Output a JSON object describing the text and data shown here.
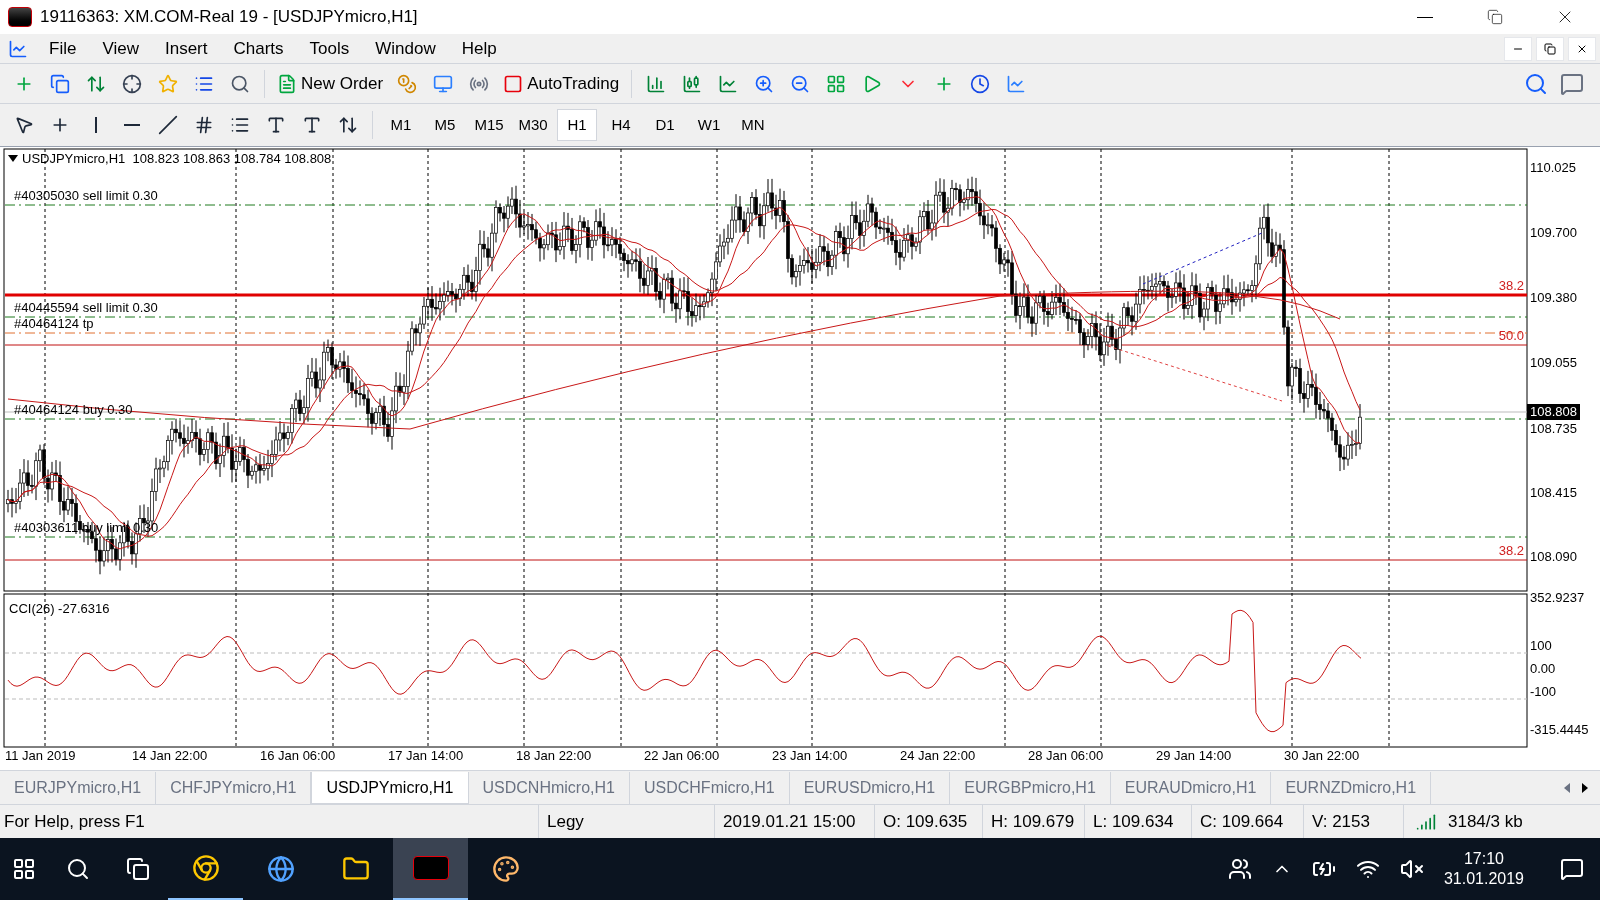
{
  "window": {
    "title": "19116363: XM.COM-Real 19 - [USDJPYmicro,H1]"
  },
  "menu": [
    "File",
    "View",
    "Insert",
    "Charts",
    "Tools",
    "Window",
    "Help"
  ],
  "toolbar": {
    "new_order": "New Order",
    "autotrading": "AutoTrading"
  },
  "timeframes": [
    {
      "label": "M1",
      "selected": false
    },
    {
      "label": "M5",
      "selected": false
    },
    {
      "label": "M15",
      "selected": false
    },
    {
      "label": "M30",
      "selected": false
    },
    {
      "label": "H1",
      "selected": true
    },
    {
      "label": "H4",
      "selected": false
    },
    {
      "label": "D1",
      "selected": false
    },
    {
      "label": "W1",
      "selected": false
    },
    {
      "label": "MN",
      "selected": false
    }
  ],
  "chart": {
    "header": "USDJPYmicro,H1  108.823 108.863 108.784 108.808",
    "orders": [
      {
        "label": "#40305030 sell limit 0.30",
        "kind": "pending"
      },
      {
        "label": "#40445594 sell limit 0.30",
        "kind": "pending"
      },
      {
        "label": "#40464124 tp",
        "kind": "tp"
      },
      {
        "label": "#40464124 buy 0.30",
        "kind": "pending"
      },
      {
        "label": "#40303611 buy limit 0.30",
        "kind": "pending"
      }
    ],
    "fib_labels": [
      "38.2",
      "50.0",
      "38.2"
    ],
    "price_axis": [
      "110.025",
      "109.700",
      "109.380",
      "109.055",
      "108.735",
      "108.415",
      "108.090"
    ],
    "current_price": "108.808",
    "time_axis": [
      "11 Jan 2019",
      "14 Jan 22:00",
      "16 Jan 06:00",
      "17 Jan 14:00",
      "18 Jan 22:00",
      "22 Jan 06:00",
      "23 Jan 14:00",
      "24 Jan 22:00",
      "28 Jan 06:00",
      "29 Jan 14:00",
      "30 Jan 22:00"
    ],
    "indicator": {
      "label": "CCI(26) -27.6316",
      "axis": [
        "352.9237",
        "100",
        "0.00",
        "-100",
        "-315.4445"
      ]
    }
  },
  "chart_tabs": [
    {
      "label": "EURJPYmicro,H1",
      "selected": false
    },
    {
      "label": "CHFJPYmicro,H1",
      "selected": false
    },
    {
      "label": "USDJPYmicro,H1",
      "selected": true
    },
    {
      "label": "USDCNHmicro,H1",
      "selected": false
    },
    {
      "label": "USDCHFmicro,H1",
      "selected": false
    },
    {
      "label": "EURUSDmicro,H1",
      "selected": false
    },
    {
      "label": "EURGBPmicro,H1",
      "selected": false
    },
    {
      "label": "EURAUDmicro,H1",
      "selected": false
    },
    {
      "label": "EURNZDmicro,H1",
      "selected": false
    }
  ],
  "status_bar": {
    "help": "For Help, press F1",
    "profile": "Legy",
    "time": "2019.01.21 15:00",
    "open": "O: 109.635",
    "high": "H: 109.679",
    "low": "L: 109.634",
    "close": "C: 109.664",
    "volume": "V: 2153",
    "traffic": "3184/3 kb"
  },
  "taskbar": {
    "time": "17:10",
    "date": "31.01.2019"
  }
}
